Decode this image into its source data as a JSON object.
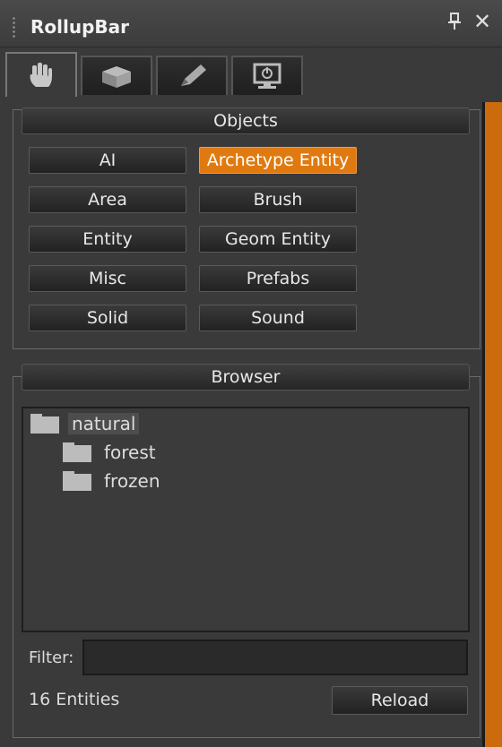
{
  "window": {
    "title": "RollupBar"
  },
  "tabs": [
    {
      "icon": "hand-icon",
      "active": true
    },
    {
      "icon": "cube-icon",
      "active": false
    },
    {
      "icon": "pencil-icon",
      "active": false
    },
    {
      "icon": "monitor-power-icon",
      "active": false
    }
  ],
  "objects": {
    "header": "Objects",
    "buttons": [
      {
        "label": "AI",
        "selected": false
      },
      {
        "label": "Archetype Entity",
        "selected": true
      },
      {
        "label": "Area",
        "selected": false
      },
      {
        "label": "Brush",
        "selected": false
      },
      {
        "label": "Entity",
        "selected": false
      },
      {
        "label": "Geom Entity",
        "selected": false
      },
      {
        "label": "Misc",
        "selected": false
      },
      {
        "label": "Prefabs",
        "selected": false
      },
      {
        "label": "Solid",
        "selected": false
      },
      {
        "label": "Sound",
        "selected": false
      }
    ]
  },
  "browser": {
    "header": "Browser",
    "tree": [
      {
        "label": "natural",
        "depth": 0,
        "selected": true
      },
      {
        "label": "forest",
        "depth": 1,
        "selected": false
      },
      {
        "label": "frozen",
        "depth": 1,
        "selected": false
      }
    ],
    "filter_label": "Filter:",
    "filter_value": "",
    "count": "16 Entities",
    "reload_label": "Reload"
  },
  "colors": {
    "accent": "#e07a10",
    "panel": "#3a3a3a",
    "side_strip": "#cc6a0e"
  }
}
